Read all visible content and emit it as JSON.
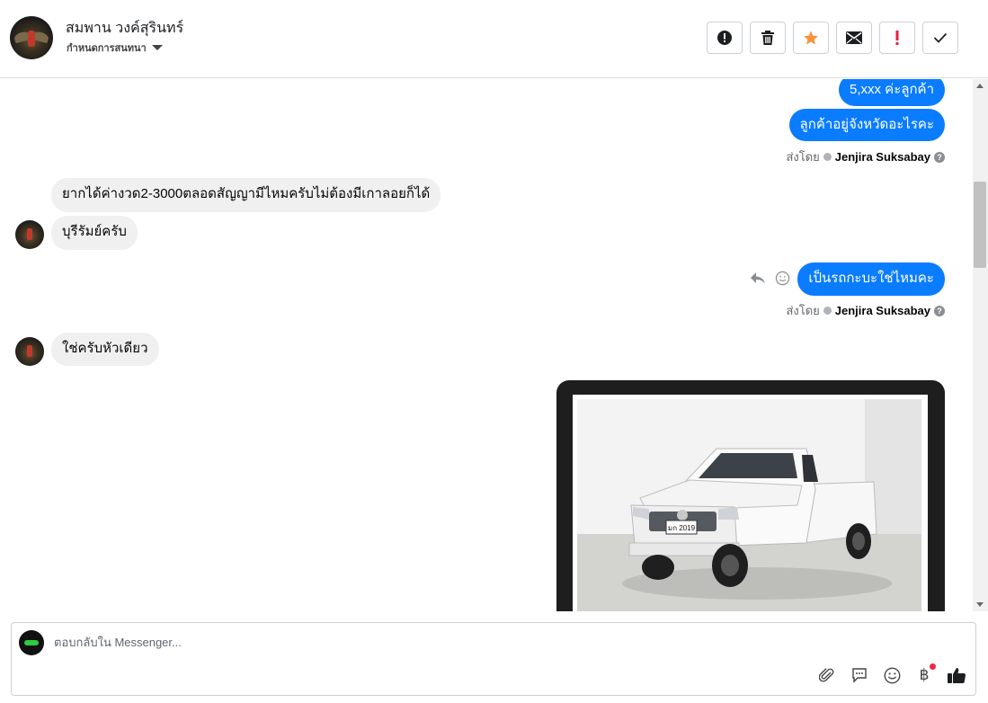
{
  "header": {
    "name": "สมพาน วงค์สุรินทร์",
    "subtitle": "กำหนดการสนทนา"
  },
  "toolbar": {
    "buttons": [
      "alert-circle-icon",
      "trash-icon",
      "star-icon",
      "envelope-icon",
      "exclamation-icon",
      "check-icon"
    ]
  },
  "messages": {
    "m1": "5,xxx ค่ะลูกค้า",
    "m2": "ลูกค้าอยู่จังหวัดอะไรคะ",
    "sent1_prefix": "ส่งโดย",
    "sent1_name": "Jenjira Suksabay",
    "m3": "ยากได้ค่างวด2-3000ตลอดสัญญามีไหมครับไม่ต้องมีเกาลอยก็ได้",
    "m4": "บุรีรัมย์ครับ",
    "m5": "เป็นรถกะบะใช่ไหมคะ",
    "sent2_prefix": "ส่งโดย",
    "sent2_name": "Jenjira Suksabay",
    "m6": "ใช่ครับหัวเดียว",
    "plate": "มก 2019"
  },
  "composer": {
    "placeholder": "ตอบกลับใน Messenger...",
    "currency_symbol": "฿"
  },
  "colors": {
    "outgoing": "#0a7cff",
    "incoming": "#f0f0f0",
    "star": "#f7923a",
    "alert": "#e41e3f"
  }
}
